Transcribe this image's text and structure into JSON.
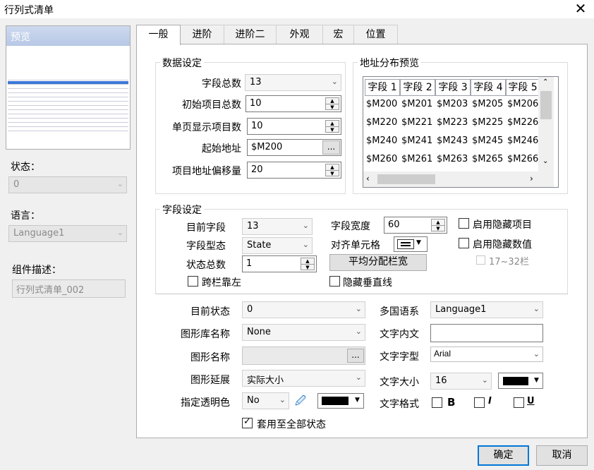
{
  "window": {
    "title": "行列式清单",
    "close_icon": "✕"
  },
  "preview": {
    "label": "预览"
  },
  "left": {
    "state_label": "状态：",
    "state_value": "0",
    "language_label": "语言：",
    "language_value": "Language1",
    "desc_label": "组件描述：",
    "desc_value": "行列式清单_002"
  },
  "tabs": [
    "一般",
    "进阶",
    "进阶二",
    "外观",
    "宏",
    "位置"
  ],
  "data_settings": {
    "title": "数据设定",
    "field_count_label": "字段总数",
    "field_count_value": "13",
    "init_items_label": "初始项目总数",
    "init_items_value": "10",
    "page_items_label": "单页显示项目数",
    "page_items_value": "10",
    "start_addr_label": "起始地址",
    "start_addr_value": "$M200",
    "browse": "...",
    "offset_label": "项目地址偏移量",
    "offset_value": "20"
  },
  "addr_preview": {
    "title": "地址分布预览",
    "columns": [
      "字段 1",
      "字段 2",
      "字段 3",
      "字段 4",
      "字段 5"
    ],
    "rows": [
      [
        "$M200",
        "$M201",
        "$M203",
        "$M205",
        "$M206"
      ],
      [
        "$M220",
        "$M221",
        "$M223",
        "$M225",
        "$M226"
      ],
      [
        "$M240",
        "$M241",
        "$M243",
        "$M245",
        "$M246"
      ],
      [
        "$M260",
        "$M261",
        "$M263",
        "$M265",
        "$M266"
      ]
    ]
  },
  "field_settings": {
    "title": "字段设定",
    "cur_field_label": "目前字段",
    "cur_field_value": "13",
    "field_type_label": "字段型态",
    "field_type_value": "State",
    "state_count_label": "状态总数",
    "state_count_value": "1",
    "field_width_label": "字段宽度",
    "field_width_value": "60",
    "align_label": "对齐单元格",
    "distribute_button": "平均分配栏宽",
    "hide_item_label": "启用隐藏项目",
    "hide_value_label": "启用隐藏数值",
    "col_range_label": "17~32栏",
    "span_left_label": "跨栏靠左",
    "hide_vline_label": "隐藏垂直线"
  },
  "state_settings": {
    "cur_state_label": "目前状态",
    "cur_state_value": "0",
    "gallery_label": "图形库名称",
    "gallery_value": "None",
    "graphic_label": "图形名称",
    "graphic_value": "",
    "browse": "...",
    "extend_label": "图形延展",
    "extend_value": "实际大小",
    "transparent_label": "指定透明色",
    "transparent_value": "No",
    "apply_all_label": "套用至全部状态",
    "lang_label": "多国语系",
    "lang_value": "Language1",
    "text_label": "文字内文",
    "text_value": "",
    "font_label": "文字字型",
    "font_value": "Arial",
    "size_label": "文字大小",
    "size_value": "16",
    "format_label": "文字格式",
    "bold": "B",
    "italic": "I",
    "underline": "U"
  },
  "buttons": {
    "ok": "确定",
    "cancel": "取消"
  },
  "colors": {
    "accent": "#0078d7",
    "text_color": "#000000",
    "transparent_color": "#000000"
  }
}
